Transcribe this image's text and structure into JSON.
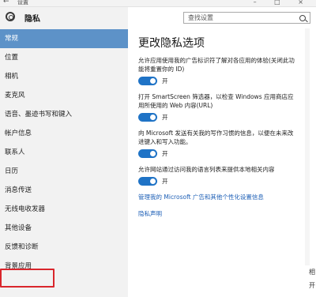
{
  "titlebar": {
    "back_glyph": "←",
    "title": "设置",
    "controls": "– □ ×"
  },
  "sidebar": {
    "title": "隐私",
    "items": [
      {
        "label": "常规",
        "active": true
      },
      {
        "label": "位置"
      },
      {
        "label": "相机"
      },
      {
        "label": "麦克风"
      },
      {
        "label": "语音、墨迹书写和键入"
      },
      {
        "label": "帐户信息"
      },
      {
        "label": "联系人"
      },
      {
        "label": "日历"
      },
      {
        "label": "消息传送"
      },
      {
        "label": "无线电收发器"
      },
      {
        "label": "其他设备"
      },
      {
        "label": "反馈和诊断"
      },
      {
        "label": "背景应用",
        "highlight": true
      }
    ]
  },
  "search": {
    "placeholder": "查找设置"
  },
  "main": {
    "title": "更改隐私选项",
    "settings": [
      {
        "desc": "允许应用使用我的广告标识符了解对各应用的体验(关闭此功能将重置你的 ID)",
        "state": "开"
      },
      {
        "desc": "打开 SmartScreen 筛选器，以检查 Windows 应用商店应用所使用的 Web 内容(URL)",
        "state": "开"
      },
      {
        "desc": "向 Microsoft 发送有关我的写作习惯的信息，以便在未来改进键入和写入功能。",
        "state": "开"
      },
      {
        "desc": "允许网站通过访问我的语言列表来提供本地相关内容",
        "state": "开"
      }
    ],
    "links": [
      "管理我的 Microsoft 广告和其他个性化设置信息",
      "隐私声明"
    ]
  },
  "edge": {
    "t1": "相",
    "t2": "开"
  },
  "colors": {
    "accent": "#1f73c6",
    "active_nav": "#5d92c8",
    "highlight_border": "#d9262c",
    "link": "#1d5fb6"
  }
}
